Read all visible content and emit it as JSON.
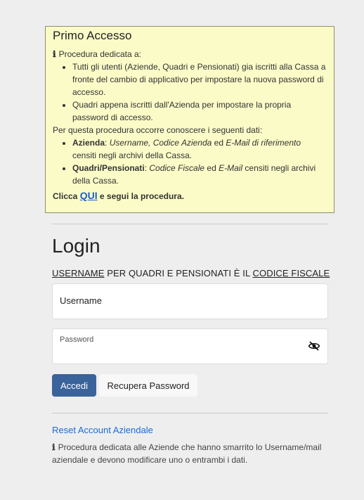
{
  "notice": {
    "title": "Primo Accesso",
    "intro": "Procedura dedicata a:",
    "items": [
      "Tutti gli utenti (Aziende, Quadri e Pensionati) gia iscritti alla Cassa a fronte del cambio di applicativo per impostare la nuova password di accesso.",
      "Quadri appena iscritti dall'Azienda per impostare la propria password di accesso."
    ],
    "requirements_intro": "Per questa procedura occorre conoscere i seguenti dati:",
    "req_azienda": {
      "label": "Azienda",
      "sep1": ": ",
      "f1": "Username, Codice Azienda",
      "and": " ed ",
      "f2": "E-Mail di riferimento",
      "tail": " censiti negli archivi della Cassa."
    },
    "req_quadri": {
      "label": "Quadri/Pensionati",
      "sep1": ": ",
      "f1": "Codice Fiscale",
      "and": " ed ",
      "f2": "E-Mail",
      "tail": " censiti negli archivi della Cassa."
    },
    "cta_prefix": "Clicca ",
    "cta_link": "QUI",
    "cta_suffix": " e segui la procedura."
  },
  "login": {
    "title": "Login",
    "hint_username": "USERNAME",
    "hint_middle": " PER QUADRI E PENSIONATI È IL ",
    "hint_cf": "CODICE FISCALE",
    "username_value": "Username",
    "password_label": "Password",
    "password_value": "",
    "submit_label": "Accedi",
    "recover_label": "Recupera Password"
  },
  "reset": {
    "link_label": "Reset Account Aziendale",
    "description": "Procedura dedicata alle Aziende che hanno smarrito lo Username/mail aziendale e devono modificare uno o entrambi i dati."
  },
  "icons": {
    "info": "info-icon",
    "eye": "eye-slash-icon"
  },
  "colors": {
    "notice_bg": "#fbfbc8",
    "primary_button": "#3a639b",
    "link": "#1d6ad8"
  }
}
